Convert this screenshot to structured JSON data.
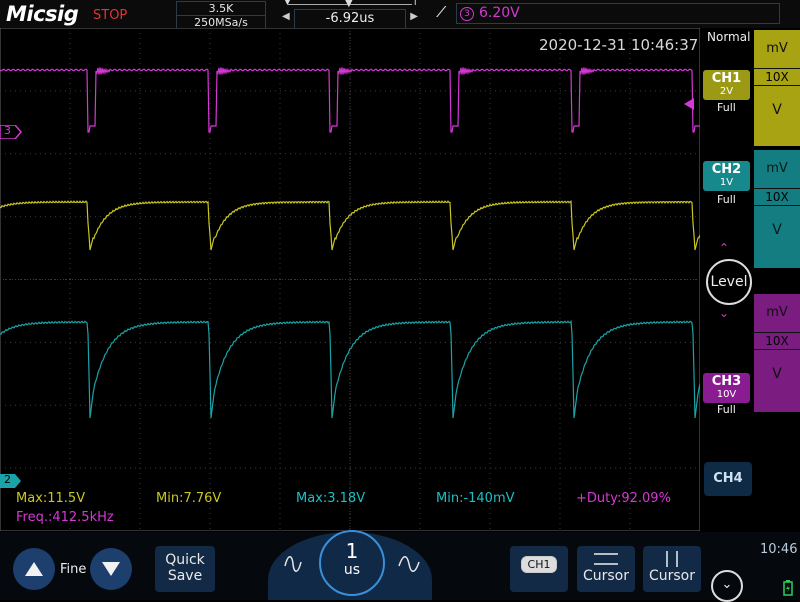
{
  "brand": {
    "logo": "Micsig",
    "status": "STOP"
  },
  "acquisition": {
    "memory_depth": "3.5K",
    "sample_rate": "250MSa/s"
  },
  "trigger_position": {
    "value": "-6.92us"
  },
  "trigger": {
    "source_number": "3",
    "level": "6.20V"
  },
  "timestamp": "2020-12-31 10:46:37",
  "trigger_mode": "Normal",
  "channels": [
    {
      "name": "CH1",
      "scale": "2V",
      "bandwidth": "Full",
      "color": "#c9c720",
      "probe_unit": "mV",
      "probe_ratio": "10X",
      "probe_v": "V"
    },
    {
      "name": "CH2",
      "scale": "1V",
      "bandwidth": "Full",
      "color": "#1aa3a8",
      "probe_unit": "mV",
      "probe_ratio": "10X",
      "probe_v": "V"
    },
    {
      "name": "CH3",
      "scale": "10V",
      "bandwidth": "Full",
      "color": "#a021a8",
      "probe_unit": "mV",
      "probe_ratio": "10X",
      "probe_v": "V"
    },
    {
      "name": "CH4"
    }
  ],
  "markers": {
    "ch3": "3",
    "ch2": "2"
  },
  "level_button": "Level",
  "measurements": {
    "m1": "Max:11.5V",
    "m2": "Min:7.76V",
    "m3": "Max:3.18V",
    "m4": "Min:-140mV",
    "m5": "+Duty:92.09%",
    "m6": "Freq.:412.5kHz"
  },
  "bottom": {
    "fine_label": "Fine",
    "quick_save_line1": "Quick",
    "quick_save_line2": "Save",
    "timebase_value": "1",
    "timebase_unit": "us",
    "ch_badge": "CH1",
    "cursor1": "Cursor",
    "cursor2": "Cursor",
    "clock": "10:46"
  }
}
